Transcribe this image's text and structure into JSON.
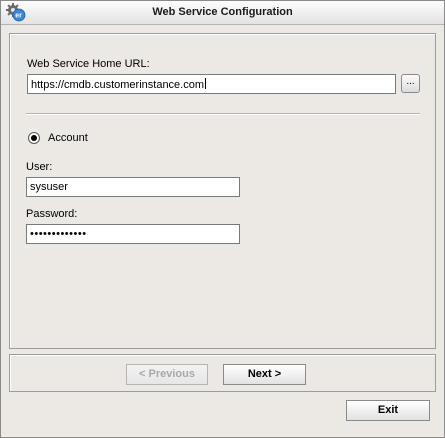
{
  "window": {
    "title": "Web Service Configuration",
    "app_icon": "gear-er-icon"
  },
  "form": {
    "url_label": "Web Service Home URL:",
    "url_value": "https://cmdb.customerinstance.com",
    "browse_label": "...",
    "auth_option_label": "Account",
    "auth_option_selected": true,
    "user_label": "User:",
    "user_value": "sysuser",
    "password_label": "Password:",
    "password_value": "•••••••••••••"
  },
  "nav": {
    "previous_label": "< Previous",
    "previous_enabled": false,
    "next_label": "Next >"
  },
  "footer": {
    "exit_label": "Exit"
  }
}
